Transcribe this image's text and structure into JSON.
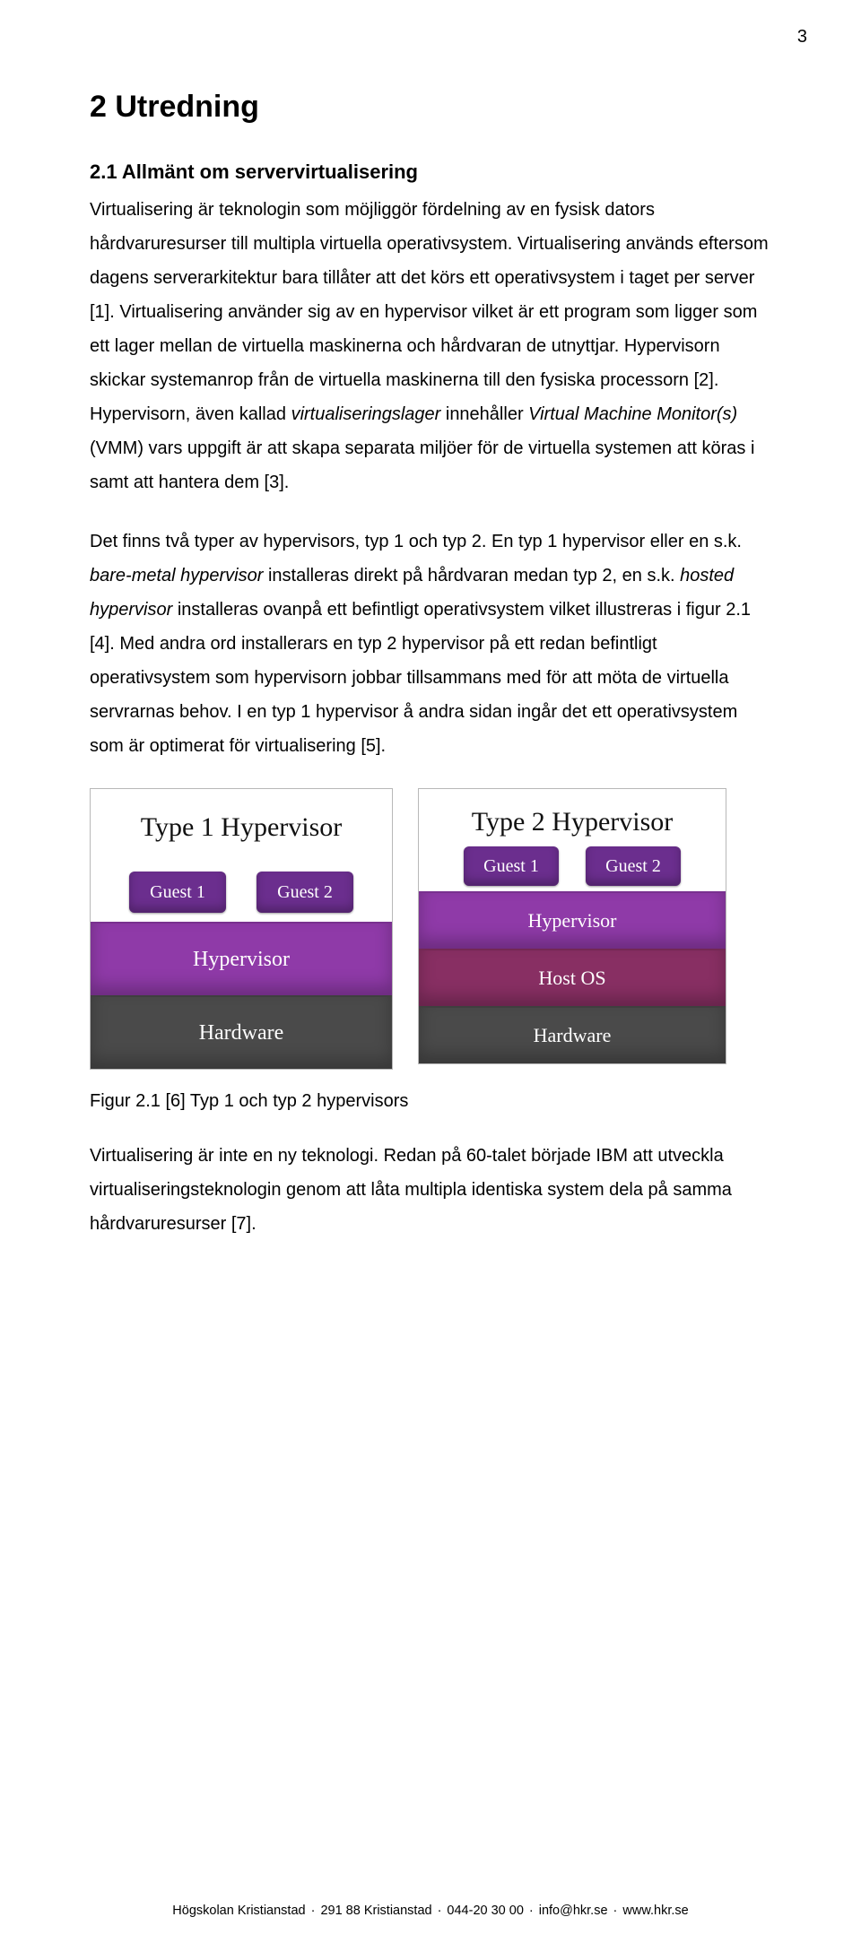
{
  "page_number": "3",
  "headings": {
    "h1": "2 Utredning",
    "h2": "2.1 Allmänt om servervirtualisering"
  },
  "paragraphs": {
    "p1_pre": "Virtualisering är teknologin som möjliggör fördelning av en fysisk dators hårdvaruresurser till multipla virtuella operativsystem. Virtualisering används eftersom dagens serverarkitektur bara tillåter att det körs ett operativsystem i taget per server [1]. Virtualisering använder sig av en hypervisor vilket är ett program som ligger som ett lager mellan de virtuella maskinerna och hårdvaran de utnyttjar. Hypervisorn skickar systemanrop från de virtuella maskinerna till den fysiska processorn [2]. Hypervisorn, även kallad ",
    "p1_em1": "virtualiseringslager",
    "p1_mid1": " innehåller ",
    "p1_em2": "Virtual Machine Monitor(s)",
    "p1_post": " (VMM) vars uppgift är att skapa separata miljöer för de virtuella systemen att köras i samt att hantera dem [3].",
    "p2_pre": "Det finns två typer av hypervisors, typ 1 och typ 2. En typ 1 hypervisor eller en s.k. ",
    "p2_em1": "bare-metal hypervisor",
    "p2_mid1": " installeras direkt på hårdvaran medan typ 2, en s.k. ",
    "p2_em2": "hosted hypervisor",
    "p2_post": " installeras ovanpå ett befintligt operativsystem vilket illustreras i figur 2.1 [4]. Med andra ord installerars en typ 2 hypervisor på ett redan befintligt operativsystem som hypervisorn jobbar tillsammans med för att möta de virtuella servrarnas behov. I en typ 1 hypervisor å andra sidan ingår det ett operativsystem som är optimerat för virtualisering [5].",
    "p3": "Virtualisering är inte en ny teknologi. Redan på 60-talet började IBM att utveckla virtualiseringsteknologin genom att låta multipla identiska system dela på samma hårdvaruresurser [7]."
  },
  "figure": {
    "type1": {
      "title": "Type 1 Hypervisor",
      "guests": [
        "Guest 1",
        "Guest 2"
      ],
      "layers": [
        "Hypervisor",
        "Hardware"
      ]
    },
    "type2": {
      "title": "Type 2 Hypervisor",
      "guests": [
        "Guest 1",
        "Guest 2"
      ],
      "layers": [
        "Hypervisor",
        "Host OS",
        "Hardware"
      ]
    },
    "caption": "Figur 2.1 [6] Typ 1 och typ 2 hypervisors",
    "colors": {
      "guest": "#6b2e8e",
      "hypervisor": "#8f3aa8",
      "hostos": "#882f63",
      "hardware": "#4a4a4a"
    }
  },
  "footer": {
    "org": "Högskolan Kristianstad",
    "address": "291 88 Kristianstad",
    "phone": "044-20 30 00",
    "email": "info@hkr.se",
    "web": "www.hkr.se"
  }
}
